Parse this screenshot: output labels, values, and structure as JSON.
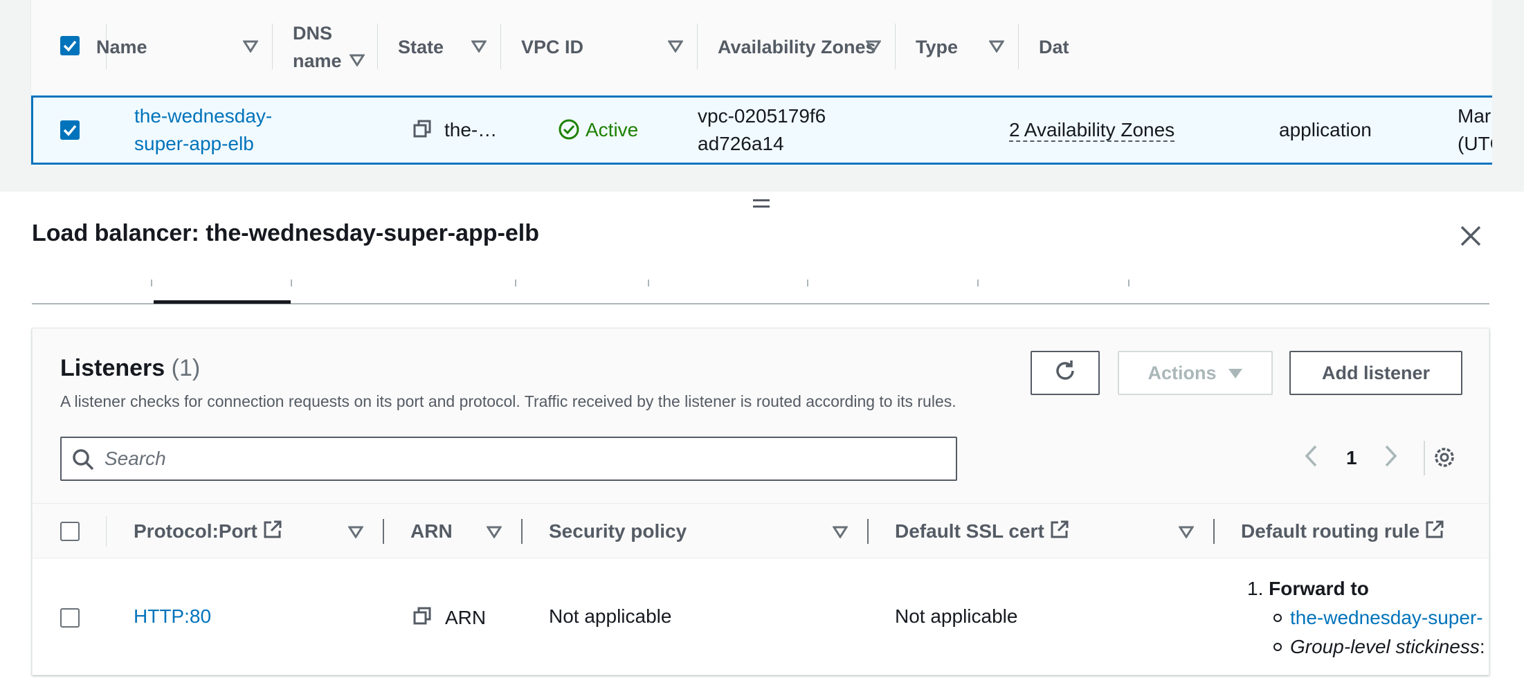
{
  "load_balancers_table": {
    "columns": [
      {
        "label": "Name"
      },
      {
        "label": "DNS name"
      },
      {
        "label": "State"
      },
      {
        "label": "VPC ID"
      },
      {
        "label": "Availability Zones"
      },
      {
        "label": "Type"
      },
      {
        "label": "Dat"
      }
    ],
    "row": {
      "selected": true,
      "name": "the-wednesday-super-app-elb",
      "dns_name": "the-…",
      "state": "Active",
      "vpc_id": "vpc-0205179f6ad726a14",
      "availability_zones": "2 Availability Zones",
      "type": "application",
      "date": "Mar (UTC"
    }
  },
  "split_panel": {
    "title": "Load balancer: the-wednesday-super-app-elb"
  },
  "listeners": {
    "title": "Listeners",
    "count": "(1)",
    "description": "A listener checks for connection requests on its port and protocol. Traffic received by the listener is routed according to its rules.",
    "actions_label": "Actions",
    "add_label": "Add listener",
    "search_placeholder": "Search",
    "page": "1",
    "columns": [
      {
        "label": "Protocol:Port"
      },
      {
        "label": "ARN"
      },
      {
        "label": "Security policy"
      },
      {
        "label": "Default SSL cert"
      },
      {
        "label": "Default routing rule"
      }
    ],
    "row": {
      "protocol_port": "HTTP:80",
      "arn": "ARN",
      "security_policy": "Not applicable",
      "ssl_cert": "Not applicable",
      "rule_number": "1.",
      "rule_action": "Forward to",
      "rule_target": "the-wednesday-super-",
      "rule_stickiness_label": "Group-level stickiness",
      "rule_stickiness_sep": ":"
    }
  },
  "colors": {
    "link": "#0073bb",
    "success": "#1d8102",
    "selected_row_bg": "#f1faff"
  }
}
